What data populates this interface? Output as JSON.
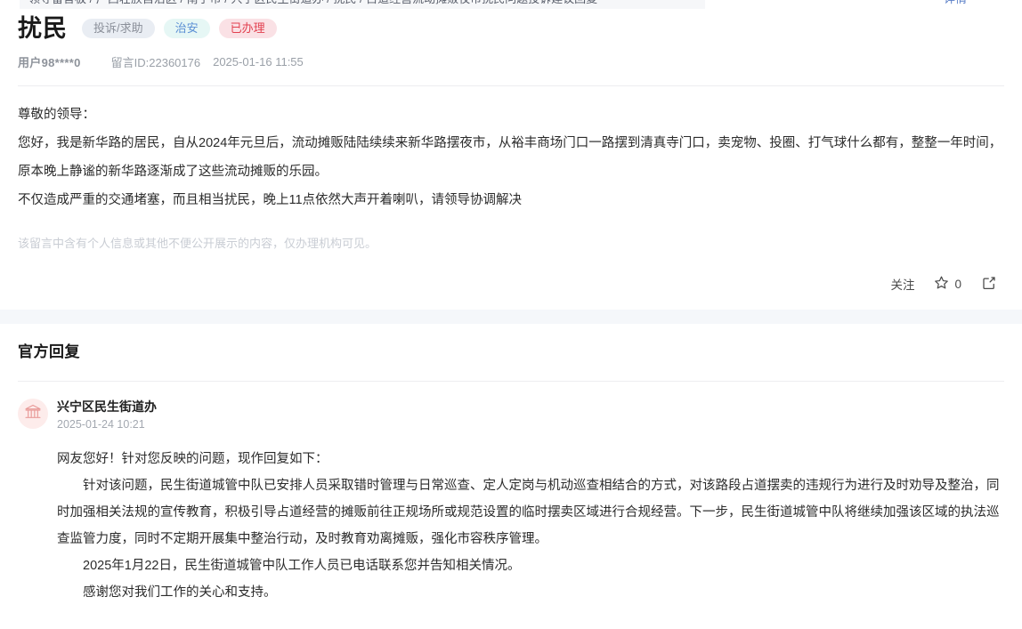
{
  "top_strip": {
    "breadcrumb_text": "领导留言板 / 广西壮族自治区 / 南宁市 / 兴宁区民生街道办 / 扰民 / 占道经营流动摊贩夜市扰民问题投诉建议回复",
    "right_link": "详情"
  },
  "post": {
    "title": "扰民",
    "tags": [
      {
        "label": "投诉/求助",
        "type": "category",
        "color": "#8a8f99",
        "bg": "#e9edf3"
      },
      {
        "label": "治安",
        "type": "topic",
        "color": "#5b8fd4",
        "bg": "#e6f7f5"
      },
      {
        "label": "已办理",
        "type": "status",
        "color": "#e2404f",
        "bg": "#fae1e5"
      }
    ],
    "meta": {
      "user": "用户98****0",
      "message_id": "留言ID:22360176",
      "time": "2025-01-16 11:55"
    },
    "paragraphs": [
      "尊敬的领导：",
      "您好，我是新华路的居民，自从2024年元旦后，流动摊贩陆陆续续来新华路摆夜市，从裕丰商场门口一路摆到清真寺门口，卖宠物、投圈、打气球什么都有，整整一年时间，原本晚上静谧的新华路逐渐成了这些流动摊贩的乐园。",
      "不仅造成严重的交通堵塞，而且相当扰民，晚上11点依然大声开着喇叭，请领导协调解决"
    ],
    "privacy_note": "该留言中含有个人信息或其他不便公开展示的内容，仅办理机构可见。",
    "actions": {
      "follow_label": "关注",
      "star_icon": "star-icon",
      "star_count": "0",
      "share_icon": "share-icon"
    }
  },
  "reply": {
    "heading": "官方回复",
    "department": {
      "avatar_icon": "government-building-icon",
      "name": "兴宁区民生街道办",
      "time": "2025-01-24 10:21"
    },
    "paragraphs": [
      {
        "text": "网友您好！针对您反映的问题，现作回复如下：",
        "indent": false
      },
      {
        "text": "针对该问题，民生街道城管中队已安排人员采取错时管理与日常巡查、定人定岗与机动巡查相结合的方式，对该路段占道摆卖的违规行为进行及时劝导及整治，同时加强相关法规的宣传教育，积极引导占道经营的摊贩前往正规场所或规范设置的临时摆卖区域进行合规经营。下一步，民生街道城管中队将继续加强该区域的执法巡查监管力度，同时不定期开展集中整治行动，及时教育劝离摊贩，强化市容秩序管理。",
        "indent": true
      },
      {
        "text": "2025年1月22日，民生街道城管中队工作人员已电话联系您并告知相关情况。",
        "indent": true
      },
      {
        "text": "感谢您对我们工作的关心和支持。",
        "indent": true
      }
    ]
  }
}
